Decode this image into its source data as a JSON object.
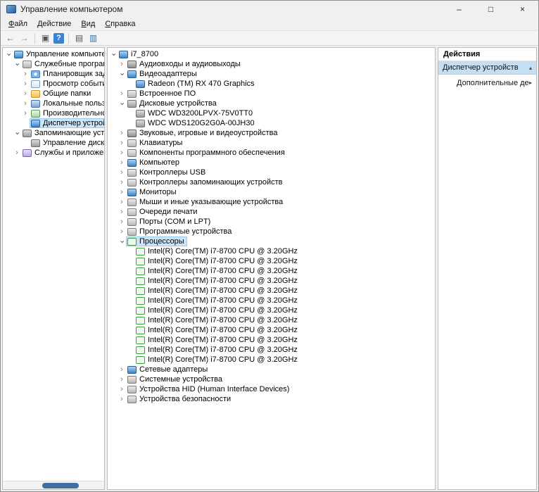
{
  "window": {
    "title": "Управление компьютером",
    "controls": {
      "minimize": "–",
      "maximize": "□",
      "close": "×"
    }
  },
  "colors": {
    "selection": "#cbe4f7",
    "actions_highlight": "#c4dff2",
    "scroll_thumb": "#3f6fa0",
    "pane_border": "#bcbcbc"
  },
  "menu": {
    "items": [
      "Файл",
      "Действие",
      "Вид",
      "Справка"
    ]
  },
  "toolbar": {
    "items": [
      {
        "name": "back-arrow-icon",
        "glyph": "←"
      },
      {
        "name": "forward-arrow-icon",
        "glyph": "→"
      },
      {
        "type": "sep"
      },
      {
        "name": "show-console-tree-icon",
        "glyph": "▣"
      },
      {
        "name": "help-icon",
        "glyph": "?"
      },
      {
        "type": "sep"
      },
      {
        "name": "export-list-icon",
        "glyph": "▤"
      },
      {
        "name": "devices-screen-icon",
        "glyph": "▥"
      }
    ]
  },
  "left_tree": {
    "items": [
      {
        "label": "Управление компьютером (л",
        "level": 0,
        "expand": "open",
        "icon": "mgmt"
      },
      {
        "label": "Служебные программы",
        "level": 1,
        "expand": "open",
        "icon": "tools"
      },
      {
        "label": "Планировщик заданий",
        "level": 2,
        "expand": "closed",
        "icon": "scheduler"
      },
      {
        "label": "Просмотр событий",
        "level": 2,
        "expand": "closed",
        "icon": "eventlog"
      },
      {
        "label": "Общие папки",
        "level": 2,
        "expand": "closed",
        "icon": "folder"
      },
      {
        "label": "Локальные пользовател",
        "level": 2,
        "expand": "closed",
        "icon": "users"
      },
      {
        "label": "Производительность",
        "level": 2,
        "expand": "closed",
        "icon": "perf"
      },
      {
        "label": "Диспетчер устройств",
        "level": 2,
        "expand": "none",
        "icon": "devmgr",
        "selected": true
      },
      {
        "label": "Запоминающие устройст",
        "level": 1,
        "expand": "open",
        "icon": "storage"
      },
      {
        "label": "Управление дисками",
        "level": 2,
        "expand": "none",
        "icon": "diskmgmt"
      },
      {
        "label": "Службы и приложения",
        "level": 1,
        "expand": "closed",
        "icon": "apps"
      }
    ]
  },
  "device_tree": {
    "items": [
      {
        "label": "i7_8700",
        "level": 0,
        "expand": "open",
        "icon": "computer"
      },
      {
        "label": "Аудиовходы и аудиовыходы",
        "level": 1,
        "expand": "closed",
        "icon": "audio"
      },
      {
        "label": "Видеоадаптеры",
        "level": 1,
        "expand": "open",
        "icon": "display"
      },
      {
        "label": "Radeon (TM) RX 470 Graphics",
        "level": 2,
        "expand": "none",
        "icon": "gpu"
      },
      {
        "label": "Встроенное ПО",
        "level": 1,
        "expand": "closed",
        "icon": "firmware"
      },
      {
        "label": "Дисковые устройства",
        "level": 1,
        "expand": "open",
        "icon": "disk"
      },
      {
        "label": "WDC WD3200LPVX-75V0TT0",
        "level": 2,
        "expand": "none",
        "icon": "hdd"
      },
      {
        "label": "WDC WDS120G2G0A-00JH30",
        "level": 2,
        "expand": "none",
        "icon": "hdd"
      },
      {
        "label": "Звуковые, игровые и видеоустройства",
        "level": 1,
        "expand": "closed",
        "icon": "sound"
      },
      {
        "label": "Клавиатуры",
        "level": 1,
        "expand": "closed",
        "icon": "keyboard"
      },
      {
        "label": "Компоненты программного обеспечения",
        "level": 1,
        "expand": "closed",
        "icon": "swcomp"
      },
      {
        "label": "Компьютер",
        "level": 1,
        "expand": "closed",
        "icon": "computer"
      },
      {
        "label": "Контроллеры USB",
        "level": 1,
        "expand": "closed",
        "icon": "usb"
      },
      {
        "label": "Контроллеры запоминающих устройств",
        "level": 1,
        "expand": "closed",
        "icon": "storctrl"
      },
      {
        "label": "Мониторы",
        "level": 1,
        "expand": "closed",
        "icon": "monitor"
      },
      {
        "label": "Мыши и иные указывающие устройства",
        "level": 1,
        "expand": "closed",
        "icon": "mouse"
      },
      {
        "label": "Очереди печати",
        "level": 1,
        "expand": "closed",
        "icon": "printer"
      },
      {
        "label": "Порты (COM и LPT)",
        "level": 1,
        "expand": "closed",
        "icon": "ports"
      },
      {
        "label": "Программные устройства",
        "level": 1,
        "expand": "closed",
        "icon": "swdev"
      },
      {
        "label": "Процессоры",
        "level": 1,
        "expand": "open",
        "icon": "cpu",
        "selected": true
      },
      {
        "label": "Intel(R) Core(TM) i7-8700 CPU @ 3.20GHz",
        "level": 2,
        "expand": "none",
        "icon": "cpu-item"
      },
      {
        "label": "Intel(R) Core(TM) i7-8700 CPU @ 3.20GHz",
        "level": 2,
        "expand": "none",
        "icon": "cpu-item"
      },
      {
        "label": "Intel(R) Core(TM) i7-8700 CPU @ 3.20GHz",
        "level": 2,
        "expand": "none",
        "icon": "cpu-item"
      },
      {
        "label": "Intel(R) Core(TM) i7-8700 CPU @ 3.20GHz",
        "level": 2,
        "expand": "none",
        "icon": "cpu-item"
      },
      {
        "label": "Intel(R) Core(TM) i7-8700 CPU @ 3.20GHz",
        "level": 2,
        "expand": "none",
        "icon": "cpu-item"
      },
      {
        "label": "Intel(R) Core(TM) i7-8700 CPU @ 3.20GHz",
        "level": 2,
        "expand": "none",
        "icon": "cpu-item"
      },
      {
        "label": "Intel(R) Core(TM) i7-8700 CPU @ 3.20GHz",
        "level": 2,
        "expand": "none",
        "icon": "cpu-item"
      },
      {
        "label": "Intel(R) Core(TM) i7-8700 CPU @ 3.20GHz",
        "level": 2,
        "expand": "none",
        "icon": "cpu-item"
      },
      {
        "label": "Intel(R) Core(TM) i7-8700 CPU @ 3.20GHz",
        "level": 2,
        "expand": "none",
        "icon": "cpu-item"
      },
      {
        "label": "Intel(R) Core(TM) i7-8700 CPU @ 3.20GHz",
        "level": 2,
        "expand": "none",
        "icon": "cpu-item"
      },
      {
        "label": "Intel(R) Core(TM) i7-8700 CPU @ 3.20GHz",
        "level": 2,
        "expand": "none",
        "icon": "cpu-item"
      },
      {
        "label": "Intel(R) Core(TM) i7-8700 CPU @ 3.20GHz",
        "level": 2,
        "expand": "none",
        "icon": "cpu-item"
      },
      {
        "label": "Сетевые адаптеры",
        "level": 1,
        "expand": "closed",
        "icon": "net"
      },
      {
        "label": "Системные устройства",
        "level": 1,
        "expand": "closed",
        "icon": "sysdev"
      },
      {
        "label": "Устройства HID (Human Interface Devices)",
        "level": 1,
        "expand": "closed",
        "icon": "hid"
      },
      {
        "label": "Устройства безопасности",
        "level": 1,
        "expand": "closed",
        "icon": "security"
      }
    ]
  },
  "actions": {
    "header": "Действия",
    "section": "Диспетчер устройств",
    "section_chevron": "▴",
    "more": "Дополнительные дей...",
    "more_chevron": "▸"
  }
}
